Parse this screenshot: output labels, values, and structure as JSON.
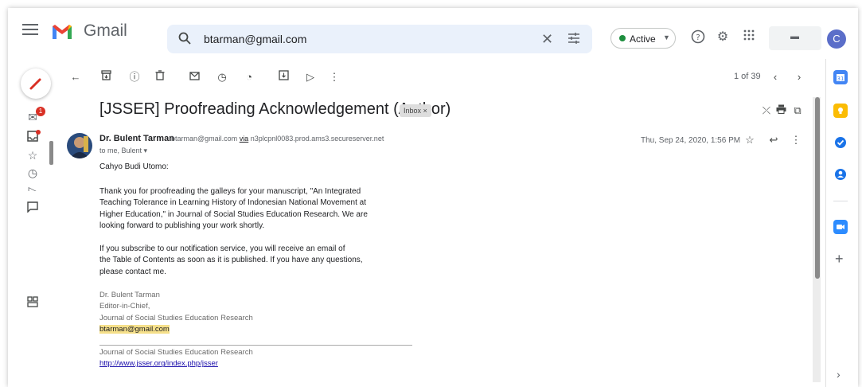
{
  "header": {
    "app_name": "Gmail",
    "search_value": "btarman@gmail.com",
    "status_label": "Active",
    "avatar_letter": "C"
  },
  "rail": {
    "inbox_badge": "1"
  },
  "toolbar": {
    "page_count": "1 of 39"
  },
  "message": {
    "subject": "[JSSER] Proofreading Acknowledgement (Author)",
    "label_chip": "Inbox ×",
    "sender_name": "Dr. Bulent Tarman",
    "sender_email": "btarman@gmail.com",
    "via_word": "via",
    "via_server": "n3plcpnl0083.prod.ams3.secureserver.net",
    "to_line": "to me, Bulent ▾",
    "date": "Thu, Sep 24, 2020, 1:56 PM",
    "greeting": "Cahyo Budi Utomo:",
    "para1": [
      "Thank you for proofreading the galleys for your manuscript, \"An Integrated",
      "Teaching Tolerance in Learning History of Indonesian National Movement at",
      "Higher Education,\" in Journal of Social Studies Education Research. We are",
      "looking forward to publishing your work shortly."
    ],
    "para2": [
      "If you subscribe to our notification service, you will receive an email of",
      "the Table of Contents as soon as it is published. If you have any questions,",
      "please contact me."
    ],
    "signature": {
      "name": "Dr. Bulent Tarman",
      "role": "Editor-in-Chief,",
      "journal": "Journal of Social Studies Education Research",
      "email": "btarman@gmail.com"
    },
    "footer": {
      "journal": "Journal of Social Studies Education Research",
      "url": "http://www.jsser.org/index.php/jsser"
    }
  },
  "colors": {
    "gmail_red": "#ea4335",
    "active_green": "#1e8e3e",
    "highlight": "#f6e08a",
    "link": "#1a0dab"
  }
}
